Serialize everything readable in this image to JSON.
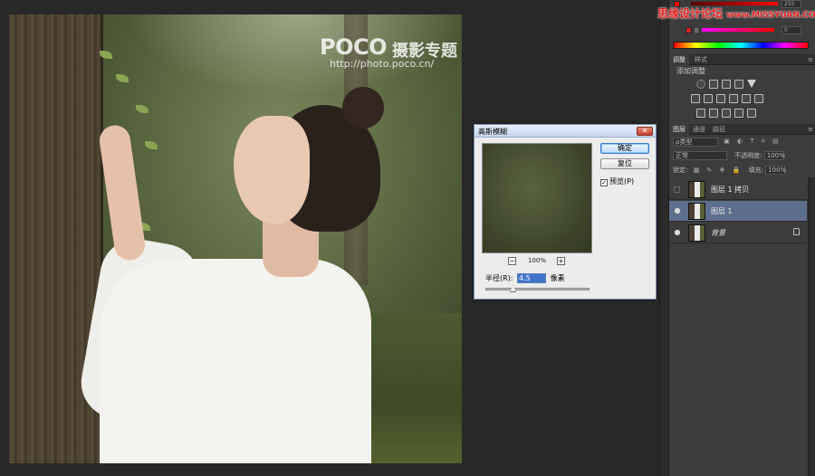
{
  "canvas": {
    "watermark_logo": "POCO",
    "watermark_logo_cn": "摄影专题",
    "watermark_url": "http://photo.poco.cn/"
  },
  "dialog": {
    "title": "高斯模糊",
    "ok_label": "确定",
    "reset_label": "复位",
    "preview_label": "预览(P)",
    "preview_checked": true,
    "zoom_minus": "−",
    "zoom_plus": "+",
    "zoom_level": "100%",
    "radius_label": "半径(R):",
    "radius_value": "4.5",
    "radius_unit": "像素",
    "radius_slider_fraction": 0.25
  },
  "site_watermark": {
    "text": "思缘设计论坛",
    "url": "www.MISSYUAN.COM"
  },
  "color_panel": {
    "r_value": "255",
    "b_value": "0"
  },
  "adjust_panel": {
    "tabs": [
      "调整",
      "样式"
    ],
    "add_label": "添加调整"
  },
  "layers_panel": {
    "tabs": [
      "图层",
      "通道",
      "路径"
    ],
    "kind_label": "ρ类型",
    "blend_mode": "正常",
    "opacity_label": "不透明度:",
    "opacity_value": "100%",
    "lock_label": "锁定:",
    "fill_label": "填充:",
    "fill_value": "100%",
    "layers": [
      {
        "name": "图层 1 拷贝",
        "visible": false,
        "selected": false,
        "italic": false
      },
      {
        "name": "图层 1",
        "visible": true,
        "selected": true,
        "italic": false
      },
      {
        "name": "背景",
        "visible": true,
        "selected": false,
        "italic": true
      }
    ]
  },
  "colors": {
    "accent": "#5e6f8d",
    "red": "#ff0000"
  }
}
